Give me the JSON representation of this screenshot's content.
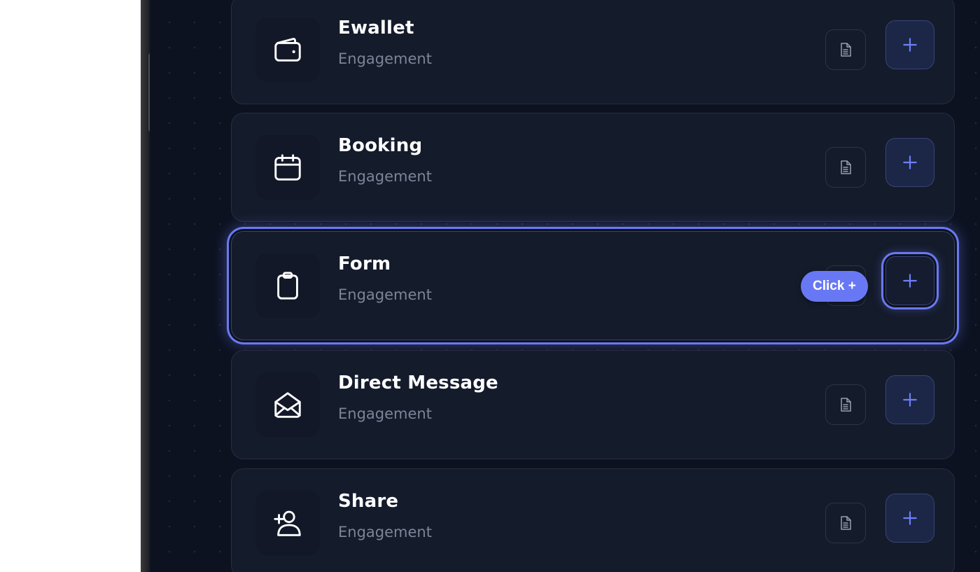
{
  "colors": {
    "canvas_bg": "#0c1220",
    "card_bg": "#141b2b",
    "accent": "#6a79f0",
    "plus_icon": "#6e7ff8",
    "title_text": "#ffffff",
    "subtitle_text": "#7d8497"
  },
  "cards": [
    {
      "title": "Ewallet",
      "subtitle": "Engagement",
      "icon": "wallet-icon"
    },
    {
      "title": "Booking",
      "subtitle": "Engagement",
      "icon": "calendar-icon"
    },
    {
      "title": "Form",
      "subtitle": "Engagement",
      "icon": "clipboard-icon",
      "selected": true
    },
    {
      "title": "Direct Message",
      "subtitle": "Engagement",
      "icon": "envelope-open-icon"
    },
    {
      "title": "Share",
      "subtitle": "Engagement",
      "icon": "user-plus-icon"
    }
  ],
  "hint": {
    "label": "Click +"
  },
  "buttons": {
    "doc_icon": "document-icon",
    "add_icon": "plus-icon"
  }
}
